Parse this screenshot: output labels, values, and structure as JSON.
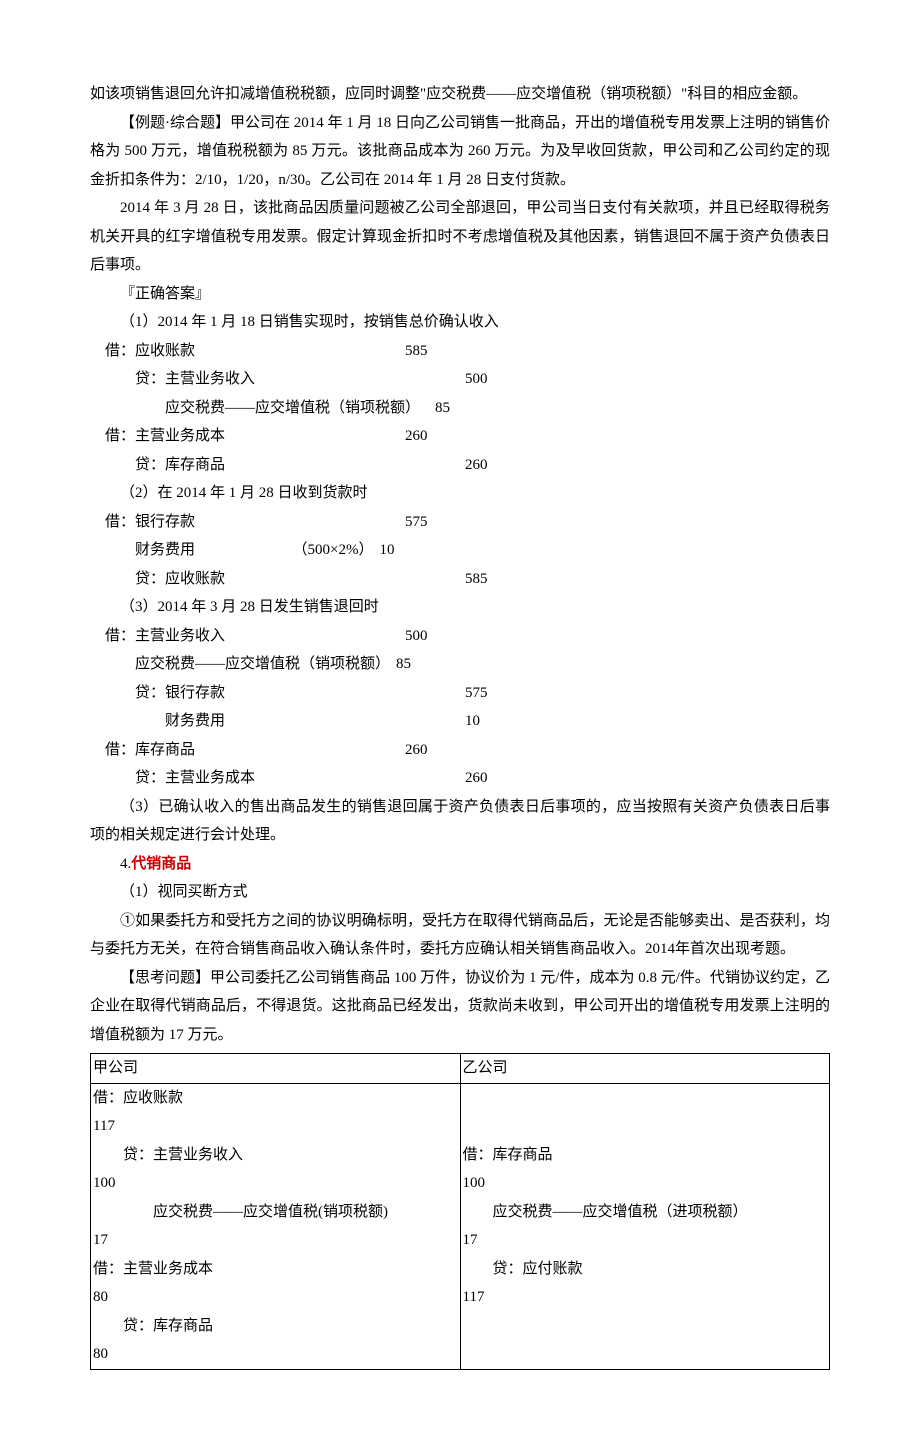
{
  "paragraphs": {
    "p1": "如该项销售退回允许扣减增值税税额，应同时调整\"应交税费——应交增值税（销项税额）\"科目的相应金额。",
    "p2": "【例题·综合题】甲公司在 2014 年 1 月 18 日向乙公司销售一批商品，开出的增值税专用发票上注明的销售价格为 500 万元，增值税税额为 85 万元。该批商品成本为 260 万元。为及早收回货款，甲公司和乙公司约定的现金折扣条件为：2/10，1/20，n/30。乙公司在 2014 年 1 月 28 日支付货款。",
    "p3": "2014 年 3 月 28 日，该批商品因质量问题被乙公司全部退回，甲公司当日支付有关款项，并且已经取得税务机关开具的红字增值税专用发票。假定计算现金折扣时不考虑增值税及其他因素，销售退回不属于资产负债表日后事项。",
    "p4": "『正确答案』",
    "p5": "（1）2014 年 1 月 18 日销售实现时，按销售总价确认收入",
    "p6": "（2）在 2014 年 1 月 28 日收到货款时",
    "p7": "（3）2014 年 3 月 28 日发生销售退回时",
    "p8": "（3）已确认收入的售出商品发生的销售退回属于资产负债表日后事项的，应当按照有关资产负债表日后事项的相关规定进行会计处理。",
    "p9_prefix": "4.",
    "p9_red": "代销商品",
    "p10": "（1）视同买断方式",
    "p11": "①如果委托方和受托方之间的协议明确标明，受托方在取得代销商品后，无论是否能够卖出、是否获利，均与委托方无关，在符合销售商品收入确认条件时，委托方应确认相关销售商品收入。2014年首次出现考题。",
    "p12": "【思考问题】甲公司委托乙公司销售商品 100 万件，协议价为 1 元/件，成本为 0.8 元/件。代销协议约定，乙企业在取得代销商品后，不得退货。这批商品已经发出，货款尚未收到，甲公司开出的增值税专用发票上注明的增值税额为 17 万元。"
  },
  "entries1": [
    {
      "left": "借：应收账款",
      "num": "585",
      "pad": 0
    },
    {
      "left": "　　贷：主营业务收入",
      "num": "500",
      "pad": 1
    },
    {
      "left": "　　　　应交税费——应交增值税（销项税额）",
      "num": "85",
      "pad": 2
    },
    {
      "left": "借：主营业务成本",
      "num": "260",
      "pad": 0
    },
    {
      "left": "　　贷：库存商品",
      "num": "260",
      "pad": 1
    }
  ],
  "entries2": [
    {
      "left": "借：银行存款",
      "num": "575",
      "pad": 0
    },
    {
      "left": "　　财务费用　　　　　　　（500×2%）",
      "num": "10",
      "pad": 0,
      "tight": true
    },
    {
      "left": "　　贷：应收账款",
      "num": "585",
      "pad": 1
    }
  ],
  "entries3": [
    {
      "left": "借：主营业务收入",
      "num": "500",
      "pad": 0
    },
    {
      "left": "　　应交税费——应交增值税（销项税额）",
      "num": "85",
      "pad": 2,
      "tight": true
    },
    {
      "left": "　　贷：银行存款",
      "num": "575",
      "pad": 1
    },
    {
      "left": "　　　　财务费用",
      "num": "10",
      "pad": 1
    },
    {
      "left": "借：库存商品",
      "num": "260",
      "pad": 0
    },
    {
      "left": "　　贷：主营业务成本",
      "num": "260",
      "pad": 1
    }
  ],
  "table": {
    "header_left": "甲公司",
    "header_right": "乙公司",
    "left_lines": [
      "借：应收账款",
      "117",
      "　　贷：主营业务收入",
      "100",
      "　　　　应交税费——应交增值税(销项税额)",
      "17",
      "借：主营业务成本",
      "80",
      "　　贷：库存商品",
      "80"
    ],
    "right_lines": [
      "",
      "",
      "借：库存商品",
      "100",
      "　　应交税费——应交增值税（进项税额）",
      "17",
      "　　贷：应付账款",
      "117",
      "",
      ""
    ]
  }
}
